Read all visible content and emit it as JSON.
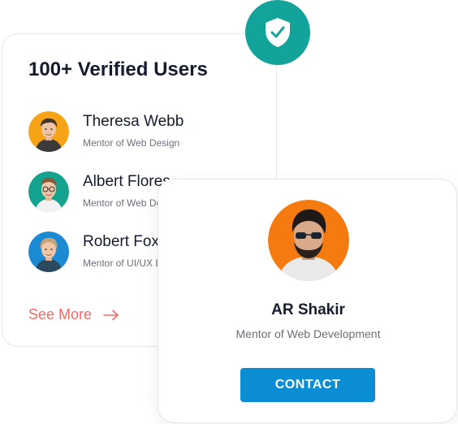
{
  "users_card": {
    "title": "100+ Verified Users",
    "users": [
      {
        "name": "Theresa Webb",
        "role": "Mentor of Web Design",
        "avatar_bg": "#f6a416"
      },
      {
        "name": "Albert Flores",
        "role": "Mentor of Web Design",
        "avatar_bg": "#14a38f"
      },
      {
        "name": "Robert Fox",
        "role": "Mentor of UI/UX Design",
        "avatar_bg": "#1b8ad3"
      }
    ],
    "see_more_label": "See More"
  },
  "badge": {
    "icon": "shield-check-icon",
    "color": "#12a39a"
  },
  "profile_card": {
    "name": "AR Shakir",
    "role": "Mentor of Web Development",
    "avatar_bg": "#f57a10",
    "contact_label": "CONTACT",
    "contact_color": "#0a8dd3"
  },
  "colors": {
    "heading": "#161c2d",
    "muted": "#6b6f7a",
    "accent": "#f26b63"
  }
}
